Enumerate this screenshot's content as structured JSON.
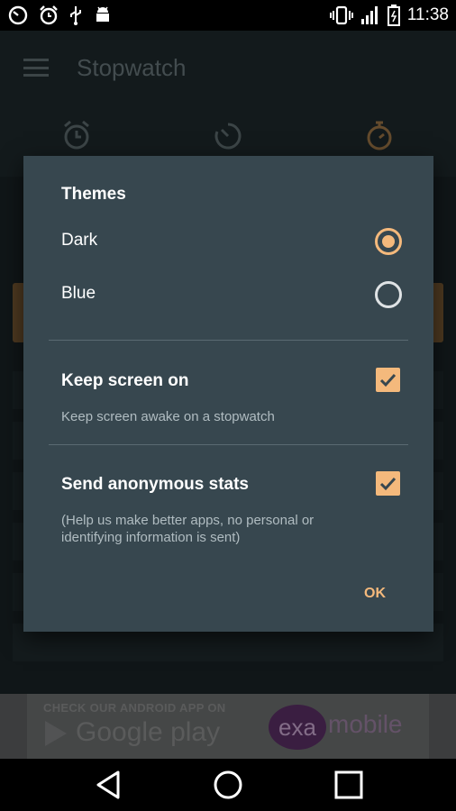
{
  "status_bar": {
    "time": "11:38",
    "left_icons": [
      "timer-icon",
      "alarm-icon",
      "usb-icon",
      "android-debug-icon"
    ],
    "right_icons": [
      "vibrate-icon",
      "signal-icon",
      "battery-icon"
    ]
  },
  "app_bar": {
    "title": "Stopwatch"
  },
  "tabs": [
    {
      "icon": "alarm-clock-icon"
    },
    {
      "icon": "timer-icon"
    },
    {
      "icon": "stopwatch-icon"
    }
  ],
  "ad": {
    "headline": "CHECK OUR ANDROID APP ON",
    "store": "Google play",
    "brand_short": "exa",
    "brand_rest": "mobile"
  },
  "dialog": {
    "themes_title": "Themes",
    "theme_options": [
      {
        "label": "Dark",
        "selected": true
      },
      {
        "label": "Blue",
        "selected": false
      }
    ],
    "keep_screen": {
      "title": "Keep screen on",
      "summary": "Keep screen awake on a stopwatch",
      "checked": true
    },
    "send_stats": {
      "title": "Send anonymous stats",
      "summary": "(Help us make better apps, no personal or identifying information is sent)",
      "checked": true
    },
    "ok_label": "OK"
  },
  "colors": {
    "accent": "#f4b97c",
    "dialog_bg": "#37474f",
    "app_bg": "#1e282b"
  }
}
